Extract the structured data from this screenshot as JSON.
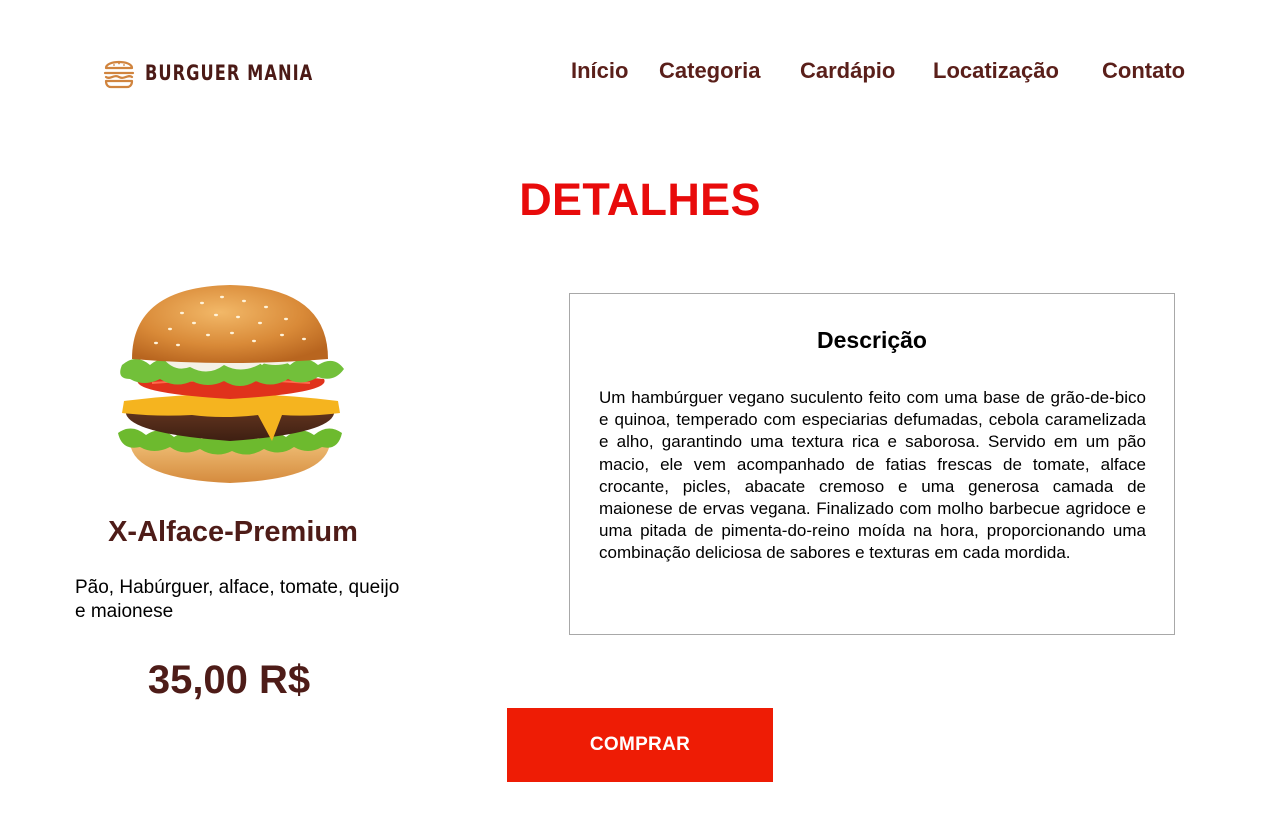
{
  "brand": {
    "name": "BURGUER MANIA",
    "logo_icon": "burger-icon",
    "logo_color": "#d0843e",
    "text_color": "#4b1a16"
  },
  "nav": {
    "items": [
      {
        "label": "Início"
      },
      {
        "label": "Categoria"
      },
      {
        "label": "Cardápio"
      },
      {
        "label": "Locatização"
      },
      {
        "label": "Contato"
      }
    ],
    "color": "#5a1f1a"
  },
  "page": {
    "title": "DETALHES",
    "title_color": "#e80b0b"
  },
  "product": {
    "image": "burger-photo",
    "name": "X-Alface-Premium",
    "ingredients": "Pão, Habúrguer, alface, tomate, queijo e maionese",
    "price": "35,00 R$"
  },
  "description": {
    "title": "Descrição",
    "text": "Um hambúrguer vegano suculento feito com uma base de grão-de-bico e quinoa, temperado com especiarias defumadas, cebola caramelizada e alho, garantindo uma textura rica e saborosa. Servido em um pão macio, ele vem acompanhado de fatias frescas de tomate, alface crocante, picles, abacate cremoso e uma generosa camada de maionese de ervas vegana. Finalizado com molho barbecue agridoce e uma pitada de pimenta-do-reino moída na hora, proporcionando uma combinação deliciosa de sabores e texturas em cada mordida."
  },
  "actions": {
    "buy_label": "COMPRAR",
    "buy_color": "#ee1c05"
  }
}
